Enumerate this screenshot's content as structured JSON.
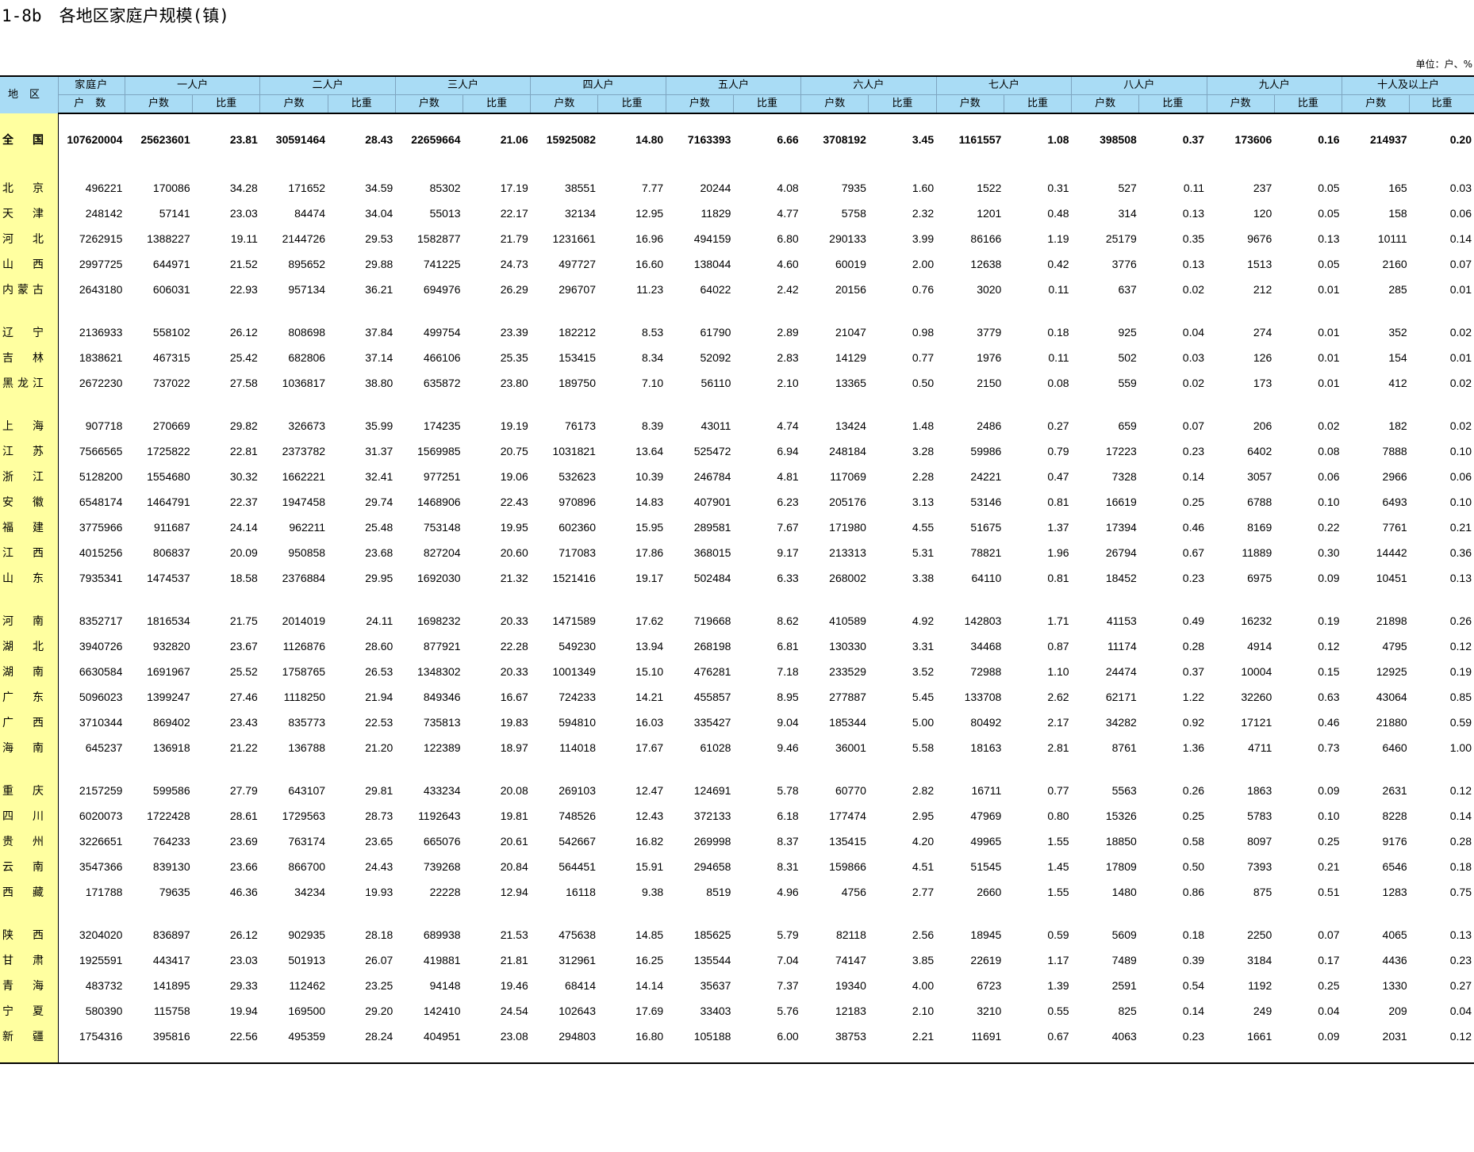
{
  "title": {
    "code": "1-8b",
    "text": "各地区家庭户规模(镇)"
  },
  "unit": "单位：户、%",
  "header": {
    "region": "地区",
    "total_top": "家庭户",
    "total_bottom": "户数",
    "groups": [
      "一人户",
      "二人户",
      "三人户",
      "四人户",
      "五人户",
      "六人户",
      "七人户",
      "八人户",
      "九人户",
      "十人及以上户"
    ],
    "sub_count": "户数",
    "sub_ratio": "比重"
  },
  "national": {
    "name": [
      "全",
      "国"
    ],
    "total": "107620004",
    "vals": [
      "25623601",
      "23.81",
      "30591464",
      "28.43",
      "22659664",
      "21.06",
      "15925082",
      "14.80",
      "7163393",
      "6.66",
      "3708192",
      "3.45",
      "1161557",
      "1.08",
      "398508",
      "0.37",
      "173606",
      "0.16",
      "214937",
      "0.20"
    ]
  },
  "groups": [
    [
      {
        "name": [
          "北",
          "京"
        ],
        "total": "496221",
        "vals": [
          "170086",
          "34.28",
          "171652",
          "34.59",
          "85302",
          "17.19",
          "38551",
          "7.77",
          "20244",
          "4.08",
          "7935",
          "1.60",
          "1522",
          "0.31",
          "527",
          "0.11",
          "237",
          "0.05",
          "165",
          "0.03"
        ]
      },
      {
        "name": [
          "天",
          "津"
        ],
        "total": "248142",
        "vals": [
          "57141",
          "23.03",
          "84474",
          "34.04",
          "55013",
          "22.17",
          "32134",
          "12.95",
          "11829",
          "4.77",
          "5758",
          "2.32",
          "1201",
          "0.48",
          "314",
          "0.13",
          "120",
          "0.05",
          "158",
          "0.06"
        ]
      },
      {
        "name": [
          "河",
          "北"
        ],
        "total": "7262915",
        "vals": [
          "1388227",
          "19.11",
          "2144726",
          "29.53",
          "1582877",
          "21.79",
          "1231661",
          "16.96",
          "494159",
          "6.80",
          "290133",
          "3.99",
          "86166",
          "1.19",
          "25179",
          "0.35",
          "9676",
          "0.13",
          "10111",
          "0.14"
        ]
      },
      {
        "name": [
          "山",
          "西"
        ],
        "total": "2997725",
        "vals": [
          "644971",
          "21.52",
          "895652",
          "29.88",
          "741225",
          "24.73",
          "497727",
          "16.60",
          "138044",
          "4.60",
          "60019",
          "2.00",
          "12638",
          "0.42",
          "3776",
          "0.13",
          "1513",
          "0.05",
          "2160",
          "0.07"
        ]
      },
      {
        "name": [
          "内",
          "蒙",
          "古"
        ],
        "total": "2643180",
        "vals": [
          "606031",
          "22.93",
          "957134",
          "36.21",
          "694976",
          "26.29",
          "296707",
          "11.23",
          "64022",
          "2.42",
          "20156",
          "0.76",
          "3020",
          "0.11",
          "637",
          "0.02",
          "212",
          "0.01",
          "285",
          "0.01"
        ]
      }
    ],
    [
      {
        "name": [
          "辽",
          "宁"
        ],
        "total": "2136933",
        "vals": [
          "558102",
          "26.12",
          "808698",
          "37.84",
          "499754",
          "23.39",
          "182212",
          "8.53",
          "61790",
          "2.89",
          "21047",
          "0.98",
          "3779",
          "0.18",
          "925",
          "0.04",
          "274",
          "0.01",
          "352",
          "0.02"
        ]
      },
      {
        "name": [
          "吉",
          "林"
        ],
        "total": "1838621",
        "vals": [
          "467315",
          "25.42",
          "682806",
          "37.14",
          "466106",
          "25.35",
          "153415",
          "8.34",
          "52092",
          "2.83",
          "14129",
          "0.77",
          "1976",
          "0.11",
          "502",
          "0.03",
          "126",
          "0.01",
          "154",
          "0.01"
        ]
      },
      {
        "name": [
          "黑",
          "龙",
          "江"
        ],
        "total": "2672230",
        "vals": [
          "737022",
          "27.58",
          "1036817",
          "38.80",
          "635872",
          "23.80",
          "189750",
          "7.10",
          "56110",
          "2.10",
          "13365",
          "0.50",
          "2150",
          "0.08",
          "559",
          "0.02",
          "173",
          "0.01",
          "412",
          "0.02"
        ]
      }
    ],
    [
      {
        "name": [
          "上",
          "海"
        ],
        "total": "907718",
        "vals": [
          "270669",
          "29.82",
          "326673",
          "35.99",
          "174235",
          "19.19",
          "76173",
          "8.39",
          "43011",
          "4.74",
          "13424",
          "1.48",
          "2486",
          "0.27",
          "659",
          "0.07",
          "206",
          "0.02",
          "182",
          "0.02"
        ]
      },
      {
        "name": [
          "江",
          "苏"
        ],
        "total": "7566565",
        "vals": [
          "1725822",
          "22.81",
          "2373782",
          "31.37",
          "1569985",
          "20.75",
          "1031821",
          "13.64",
          "525472",
          "6.94",
          "248184",
          "3.28",
          "59986",
          "0.79",
          "17223",
          "0.23",
          "6402",
          "0.08",
          "7888",
          "0.10"
        ]
      },
      {
        "name": [
          "浙",
          "江"
        ],
        "total": "5128200",
        "vals": [
          "1554680",
          "30.32",
          "1662221",
          "32.41",
          "977251",
          "19.06",
          "532623",
          "10.39",
          "246784",
          "4.81",
          "117069",
          "2.28",
          "24221",
          "0.47",
          "7328",
          "0.14",
          "3057",
          "0.06",
          "2966",
          "0.06"
        ]
      },
      {
        "name": [
          "安",
          "徽"
        ],
        "total": "6548174",
        "vals": [
          "1464791",
          "22.37",
          "1947458",
          "29.74",
          "1468906",
          "22.43",
          "970896",
          "14.83",
          "407901",
          "6.23",
          "205176",
          "3.13",
          "53146",
          "0.81",
          "16619",
          "0.25",
          "6788",
          "0.10",
          "6493",
          "0.10"
        ]
      },
      {
        "name": [
          "福",
          "建"
        ],
        "total": "3775966",
        "vals": [
          "911687",
          "24.14",
          "962211",
          "25.48",
          "753148",
          "19.95",
          "602360",
          "15.95",
          "289581",
          "7.67",
          "171980",
          "4.55",
          "51675",
          "1.37",
          "17394",
          "0.46",
          "8169",
          "0.22",
          "7761",
          "0.21"
        ]
      },
      {
        "name": [
          "江",
          "西"
        ],
        "total": "4015256",
        "vals": [
          "806837",
          "20.09",
          "950858",
          "23.68",
          "827204",
          "20.60",
          "717083",
          "17.86",
          "368015",
          "9.17",
          "213313",
          "5.31",
          "78821",
          "1.96",
          "26794",
          "0.67",
          "11889",
          "0.30",
          "14442",
          "0.36"
        ]
      },
      {
        "name": [
          "山",
          "东"
        ],
        "total": "7935341",
        "vals": [
          "1474537",
          "18.58",
          "2376884",
          "29.95",
          "1692030",
          "21.32",
          "1521416",
          "19.17",
          "502484",
          "6.33",
          "268002",
          "3.38",
          "64110",
          "0.81",
          "18452",
          "0.23",
          "6975",
          "0.09",
          "10451",
          "0.13"
        ]
      }
    ],
    [
      {
        "name": [
          "河",
          "南"
        ],
        "total": "8352717",
        "vals": [
          "1816534",
          "21.75",
          "2014019",
          "24.11",
          "1698232",
          "20.33",
          "1471589",
          "17.62",
          "719668",
          "8.62",
          "410589",
          "4.92",
          "142803",
          "1.71",
          "41153",
          "0.49",
          "16232",
          "0.19",
          "21898",
          "0.26"
        ]
      },
      {
        "name": [
          "湖",
          "北"
        ],
        "total": "3940726",
        "vals": [
          "932820",
          "23.67",
          "1126876",
          "28.60",
          "877921",
          "22.28",
          "549230",
          "13.94",
          "268198",
          "6.81",
          "130330",
          "3.31",
          "34468",
          "0.87",
          "11174",
          "0.28",
          "4914",
          "0.12",
          "4795",
          "0.12"
        ]
      },
      {
        "name": [
          "湖",
          "南"
        ],
        "total": "6630584",
        "vals": [
          "1691967",
          "25.52",
          "1758765",
          "26.53",
          "1348302",
          "20.33",
          "1001349",
          "15.10",
          "476281",
          "7.18",
          "233529",
          "3.52",
          "72988",
          "1.10",
          "24474",
          "0.37",
          "10004",
          "0.15",
          "12925",
          "0.19"
        ]
      },
      {
        "name": [
          "广",
          "东"
        ],
        "total": "5096023",
        "vals": [
          "1399247",
          "27.46",
          "1118250",
          "21.94",
          "849346",
          "16.67",
          "724233",
          "14.21",
          "455857",
          "8.95",
          "277887",
          "5.45",
          "133708",
          "2.62",
          "62171",
          "1.22",
          "32260",
          "0.63",
          "43064",
          "0.85"
        ]
      },
      {
        "name": [
          "广",
          "西"
        ],
        "total": "3710344",
        "vals": [
          "869402",
          "23.43",
          "835773",
          "22.53",
          "735813",
          "19.83",
          "594810",
          "16.03",
          "335427",
          "9.04",
          "185344",
          "5.00",
          "80492",
          "2.17",
          "34282",
          "0.92",
          "17121",
          "0.46",
          "21880",
          "0.59"
        ]
      },
      {
        "name": [
          "海",
          "南"
        ],
        "total": "645237",
        "vals": [
          "136918",
          "21.22",
          "136788",
          "21.20",
          "122389",
          "18.97",
          "114018",
          "17.67",
          "61028",
          "9.46",
          "36001",
          "5.58",
          "18163",
          "2.81",
          "8761",
          "1.36",
          "4711",
          "0.73",
          "6460",
          "1.00"
        ]
      }
    ],
    [
      {
        "name": [
          "重",
          "庆"
        ],
        "total": "2157259",
        "vals": [
          "599586",
          "27.79",
          "643107",
          "29.81",
          "433234",
          "20.08",
          "269103",
          "12.47",
          "124691",
          "5.78",
          "60770",
          "2.82",
          "16711",
          "0.77",
          "5563",
          "0.26",
          "1863",
          "0.09",
          "2631",
          "0.12"
        ]
      },
      {
        "name": [
          "四",
          "川"
        ],
        "total": "6020073",
        "vals": [
          "1722428",
          "28.61",
          "1729563",
          "28.73",
          "1192643",
          "19.81",
          "748526",
          "12.43",
          "372133",
          "6.18",
          "177474",
          "2.95",
          "47969",
          "0.80",
          "15326",
          "0.25",
          "5783",
          "0.10",
          "8228",
          "0.14"
        ]
      },
      {
        "name": [
          "贵",
          "州"
        ],
        "total": "3226651",
        "vals": [
          "764233",
          "23.69",
          "763174",
          "23.65",
          "665076",
          "20.61",
          "542667",
          "16.82",
          "269998",
          "8.37",
          "135415",
          "4.20",
          "49965",
          "1.55",
          "18850",
          "0.58",
          "8097",
          "0.25",
          "9176",
          "0.28"
        ]
      },
      {
        "name": [
          "云",
          "南"
        ],
        "total": "3547366",
        "vals": [
          "839130",
          "23.66",
          "866700",
          "24.43",
          "739268",
          "20.84",
          "564451",
          "15.91",
          "294658",
          "8.31",
          "159866",
          "4.51",
          "51545",
          "1.45",
          "17809",
          "0.50",
          "7393",
          "0.21",
          "6546",
          "0.18"
        ]
      },
      {
        "name": [
          "西",
          "藏"
        ],
        "total": "171788",
        "vals": [
          "79635",
          "46.36",
          "34234",
          "19.93",
          "22228",
          "12.94",
          "16118",
          "9.38",
          "8519",
          "4.96",
          "4756",
          "2.77",
          "2660",
          "1.55",
          "1480",
          "0.86",
          "875",
          "0.51",
          "1283",
          "0.75"
        ]
      }
    ],
    [
      {
        "name": [
          "陕",
          "西"
        ],
        "total": "3204020",
        "vals": [
          "836897",
          "26.12",
          "902935",
          "28.18",
          "689938",
          "21.53",
          "475638",
          "14.85",
          "185625",
          "5.79",
          "82118",
          "2.56",
          "18945",
          "0.59",
          "5609",
          "0.18",
          "2250",
          "0.07",
          "4065",
          "0.13"
        ]
      },
      {
        "name": [
          "甘",
          "肃"
        ],
        "total": "1925591",
        "vals": [
          "443417",
          "23.03",
          "501913",
          "26.07",
          "419881",
          "21.81",
          "312961",
          "16.25",
          "135544",
          "7.04",
          "74147",
          "3.85",
          "22619",
          "1.17",
          "7489",
          "0.39",
          "3184",
          "0.17",
          "4436",
          "0.23"
        ]
      },
      {
        "name": [
          "青",
          "海"
        ],
        "total": "483732",
        "vals": [
          "141895",
          "29.33",
          "112462",
          "23.25",
          "94148",
          "19.46",
          "68414",
          "14.14",
          "35637",
          "7.37",
          "19340",
          "4.00",
          "6723",
          "1.39",
          "2591",
          "0.54",
          "1192",
          "0.25",
          "1330",
          "0.27"
        ]
      },
      {
        "name": [
          "宁",
          "夏"
        ],
        "total": "580390",
        "vals": [
          "115758",
          "19.94",
          "169500",
          "29.20",
          "142410",
          "24.54",
          "102643",
          "17.69",
          "33403",
          "5.76",
          "12183",
          "2.10",
          "3210",
          "0.55",
          "825",
          "0.14",
          "249",
          "0.04",
          "209",
          "0.04"
        ]
      },
      {
        "name": [
          "新",
          "疆"
        ],
        "total": "1754316",
        "vals": [
          "395816",
          "22.56",
          "495359",
          "28.24",
          "404951",
          "23.08",
          "294803",
          "16.80",
          "105188",
          "6.00",
          "38753",
          "2.21",
          "11691",
          "0.67",
          "4063",
          "0.23",
          "1661",
          "0.09",
          "2031",
          "0.12"
        ]
      }
    ]
  ]
}
